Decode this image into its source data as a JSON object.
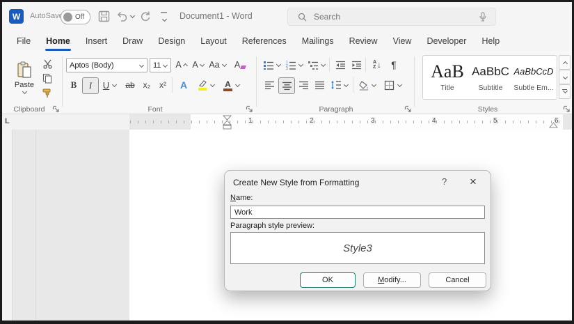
{
  "colors": {
    "accent_blue": "#185abd",
    "ok_button_border": "#1d7a68",
    "highlight_yellow": "#f5ef1f",
    "font_color_bar": "#8a4a2a"
  },
  "icons": {
    "word_logo": "W",
    "ruler_tab_selector": "L",
    "pilcrow": "¶",
    "sort_a": "A",
    "sort_z": "Z",
    "sort_arrow": "↓",
    "dialog_help": "?",
    "dialog_close": "×"
  },
  "titlebar": {
    "autosave_label": "AutoSave",
    "autosave_state": "Off",
    "document_title": "Document1 - Word",
    "search_placeholder": "Search"
  },
  "tabs": [
    {
      "label": "File",
      "active": false
    },
    {
      "label": "Home",
      "active": true
    },
    {
      "label": "Insert",
      "active": false
    },
    {
      "label": "Draw",
      "active": false
    },
    {
      "label": "Design",
      "active": false
    },
    {
      "label": "Layout",
      "active": false
    },
    {
      "label": "References",
      "active": false
    },
    {
      "label": "Mailings",
      "active": false
    },
    {
      "label": "Review",
      "active": false
    },
    {
      "label": "View",
      "active": false
    },
    {
      "label": "Developer",
      "active": false
    },
    {
      "label": "Help",
      "active": false
    }
  ],
  "ribbon": {
    "clipboard": {
      "paste_label": "Paste",
      "group_label": "Clipboard"
    },
    "font": {
      "group_label": "Font",
      "font_name": "Aptos (Body)",
      "font_size": "11",
      "grow": "A",
      "shrink": "A",
      "change_case": "Aa",
      "clear": "A",
      "bold": "B",
      "italic": "I",
      "underline": "U",
      "strikethrough": "ab",
      "subscript": "x₂",
      "superscript": "x²",
      "text_effects": "A",
      "font_color_letter": "A"
    },
    "paragraph": {
      "group_label": "Paragraph"
    },
    "styles": {
      "group_label": "Styles",
      "items": [
        {
          "preview": "AaB",
          "label": "Title"
        },
        {
          "preview": "AaBbC",
          "label": "Subtitle"
        },
        {
          "preview": "AaBbCcD",
          "label": "Subtle Em..."
        }
      ]
    }
  },
  "ruler": {
    "numbers": [
      "1",
      "2",
      "3",
      "4",
      "5",
      "6"
    ]
  },
  "dialog": {
    "title": "Create New Style from Formatting",
    "name_label": "Name:",
    "name_value": "Work",
    "preview_label": "Paragraph style preview:",
    "preview_text": "Style3",
    "buttons": {
      "ok": "OK",
      "modify": "Modify...",
      "cancel": "Cancel"
    }
  }
}
